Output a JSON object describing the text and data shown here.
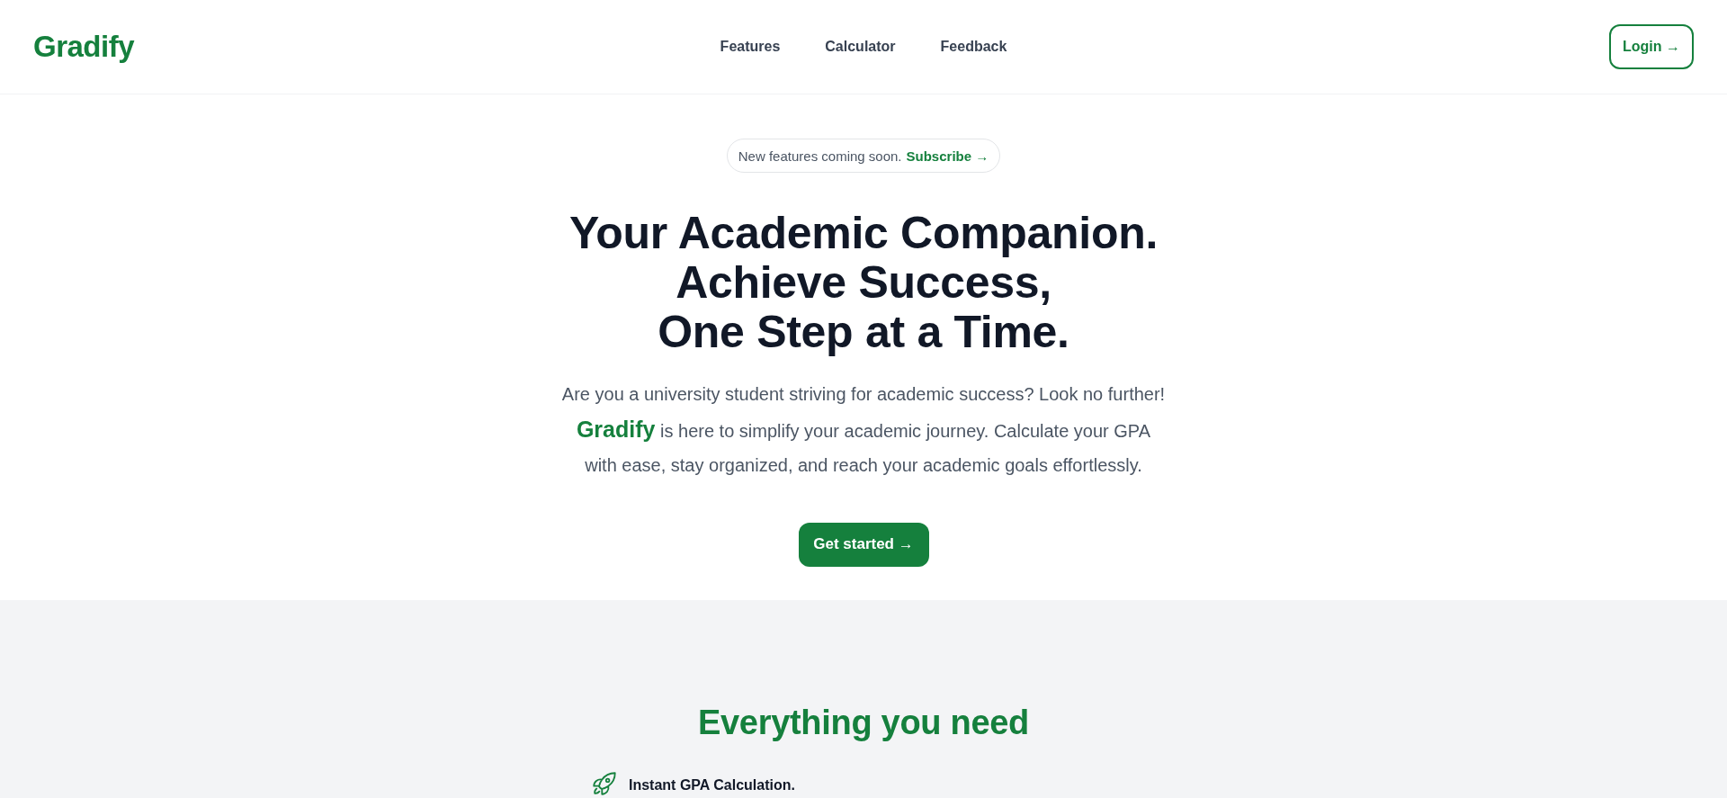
{
  "header": {
    "logo": "Gradify",
    "nav": [
      {
        "label": "Features"
      },
      {
        "label": "Calculator"
      },
      {
        "label": "Feedback"
      }
    ],
    "login_button": "Login →"
  },
  "hero": {
    "announcement": {
      "text": "New features coming soon.",
      "link": "Subscribe →"
    },
    "title_lines": [
      "Your Academic Companion.",
      "Achieve Success,",
      "One Step at a Time."
    ],
    "description": "Are you a university student striving for academic success? Look no further! **Gradify** is here to simplify your academic journey. Calculate your GPA with ease, stay organized, and reach your academic goals effortlessly.",
    "cta_button": "Get started →"
  },
  "features": {
    "heading": "Everything you need",
    "items": [
      {
        "title": "Instant GPA Calculation."
      }
    ]
  }
}
